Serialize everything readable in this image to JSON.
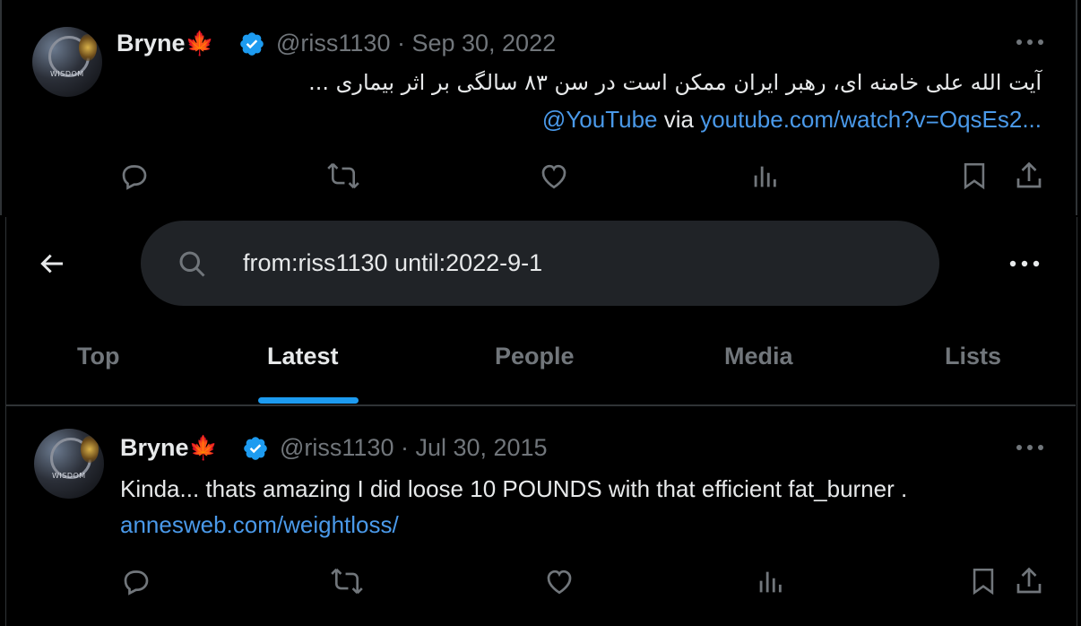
{
  "tweet1": {
    "name": "Bryne",
    "name_flag": "🍁",
    "handle_date": "@riss1130 · Sep 30, 2022",
    "text_line1": "آیت الله علی خامنه ای، رهبر ایران ممکن است در سن ۸۳ سالگی بر اثر بیماری ...",
    "mention": "@YouTube",
    "via": " via ",
    "link": "youtube.com/watch?v=OqsEs2..."
  },
  "search": {
    "query": "from:riss1130 until:2022-9-1"
  },
  "tabs": [
    "Top",
    "Latest",
    "People",
    "Media",
    "Lists"
  ],
  "active_tab": "Latest",
  "tweet2": {
    "name": "Bryne",
    "name_flag": "🍁",
    "handle_date": "@riss1130 · Jul 30, 2015",
    "text": "Kinda... thats amazing I did loose 10 POUNDS with that efficient fat_burner .",
    "link": "annesweb.com/weightloss/"
  },
  "avatar_label": "WISDOM",
  "colors": {
    "accent": "#1d9bf0",
    "link": "#4a99e9",
    "muted": "#71767b",
    "verified": "#1d9bf0"
  },
  "icons": [
    "reply-icon",
    "retweet-icon",
    "like-icon",
    "views-icon",
    "bookmark-icon",
    "share-icon",
    "more-icon",
    "back-arrow-icon",
    "search-icon",
    "verified-badge-icon"
  ]
}
